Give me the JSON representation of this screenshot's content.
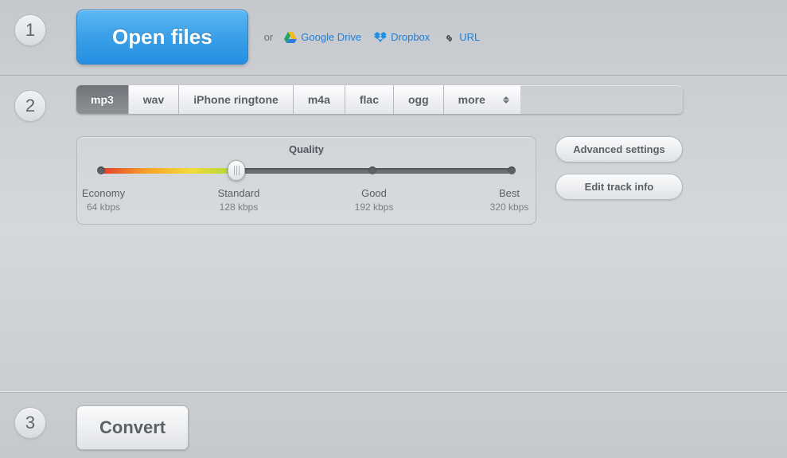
{
  "steps": {
    "one": "1",
    "two": "2",
    "three": "3"
  },
  "open": {
    "button": "Open files",
    "or": "or",
    "gdrive": "Google Drive",
    "dropbox": "Dropbox",
    "url": "URL"
  },
  "formats": {
    "mp3": "mp3",
    "wav": "wav",
    "iphone": "iPhone ringtone",
    "m4a": "m4a",
    "flac": "flac",
    "ogg": "ogg",
    "more": "more",
    "active": "mp3"
  },
  "quality": {
    "title": "Quality",
    "levels": [
      {
        "name": "Economy",
        "kbps": "64 kbps"
      },
      {
        "name": "Standard",
        "kbps": "128 kbps"
      },
      {
        "name": "Good",
        "kbps": "192 kbps"
      },
      {
        "name": "Best",
        "kbps": "320 kbps"
      }
    ],
    "selected_index": 1
  },
  "side": {
    "advanced": "Advanced settings",
    "edit_track": "Edit track info"
  },
  "convert": {
    "button": "Convert"
  }
}
